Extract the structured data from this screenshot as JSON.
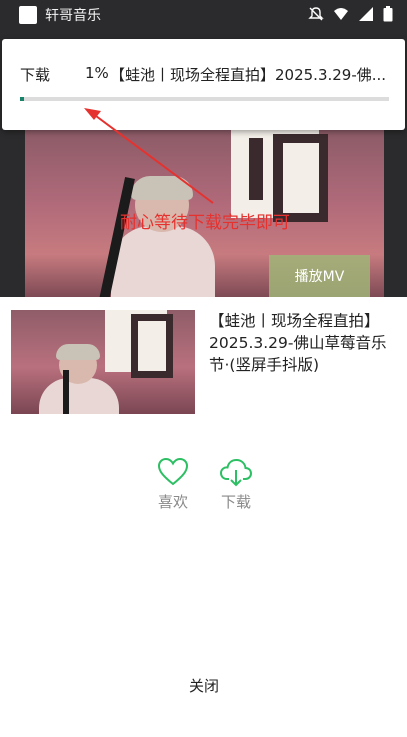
{
  "status_bar": {
    "app_name": "轩哥音乐",
    "icons": [
      "app-icon",
      "mute-icon",
      "wifi-icon",
      "signal-icon",
      "battery-icon"
    ]
  },
  "notification": {
    "label": "下载",
    "percent": "1%",
    "title": "【蛙池丨现场全程直拍】2025.3.29-佛...",
    "progress": 0.01,
    "progress_color": "#16836a"
  },
  "annotation": {
    "text": "耐心等待下载完毕即可",
    "color": "#e6322f"
  },
  "player": {
    "play_mv_label": "播放MV"
  },
  "song": {
    "title": "【蛙池丨现场全程直拍】2025.3.29-佛山草莓音乐节·(竖屏手抖版)"
  },
  "actions": {
    "like_label": "喜欢",
    "download_label": "下载",
    "accent_color": "#2dbf63"
  },
  "close_label": "关闭"
}
